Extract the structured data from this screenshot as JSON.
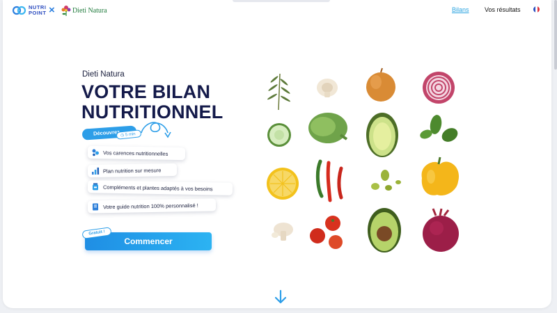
{
  "header": {
    "logo_nutri_line1": "NUTRI",
    "logo_nutri_line2": "POINT",
    "logo_separator": "×",
    "logo_dieti": "Dieti Natura",
    "nav": [
      {
        "label": "Bilans",
        "active": true
      },
      {
        "label": "Vos résultats",
        "active": false
      }
    ],
    "language_flag": "fr-flag"
  },
  "hero": {
    "brand": "Dieti Natura",
    "title_line1": "VOTRE BILAN",
    "title_line2": "NUTRITIONNEL",
    "discover_label": "Découvrez",
    "duration": "5 min",
    "features": [
      {
        "label": "Vos carences nutritionnelles",
        "icon": "molecule-icon"
      },
      {
        "label": "Plan nutrition sur mesure",
        "icon": "chart-icon"
      },
      {
        "label": "Compléments et plantes adaptés à vos besoins",
        "icon": "supplement-jar-icon"
      },
      {
        "label": "Votre guide nutrition 100% personnalisé !",
        "icon": "guide-book-icon"
      }
    ],
    "cta_label": "Commencer",
    "free_badge": "Gratuit !"
  },
  "colors": {
    "accent": "#2d9ee8",
    "title": "#141a4a",
    "nav_active": "#29a3e0"
  },
  "images": {
    "vegetables": [
      "rosemary",
      "mushroom",
      "onion",
      "red-onion",
      "cucumber",
      "artichoke",
      "avocado-half",
      "basil",
      "lemon",
      "chili-peppers",
      "olives",
      "yellow-pepper",
      "mushroom-halves",
      "cherry-tomatoes",
      "avocado-pit",
      "beetroot"
    ]
  }
}
